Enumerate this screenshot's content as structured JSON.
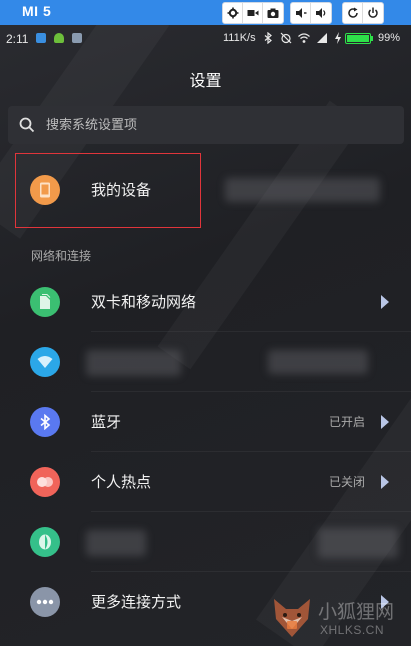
{
  "emulator": {
    "title": "MI 5",
    "buttons_left": [
      "gear-icon",
      "camera-video-icon",
      "camera-icon"
    ],
    "buttons_mid": [
      "volume-down-icon",
      "volume-up-icon"
    ],
    "buttons_right": [
      "rotate-icon",
      "power-icon"
    ]
  },
  "status_bar": {
    "time": "2:11",
    "net_speed": "111K/s",
    "battery_percent": "99%",
    "battery_level": 0.99
  },
  "header": {
    "title": "设置"
  },
  "search": {
    "placeholder": "搜索系统设置项"
  },
  "my_device": {
    "label": "我的设备",
    "icon": "phone-icon",
    "icon_color": "#f29a4a"
  },
  "section": {
    "title": "网络和连接"
  },
  "items": [
    {
      "label": "双卡和移动网络",
      "value": "",
      "icon": "sim-icon",
      "color": "#3bbf72"
    },
    {
      "label": "",
      "value": "",
      "icon": "wifi-icon",
      "color": "#2ba7e8"
    },
    {
      "label": "蓝牙",
      "value": "已开启",
      "icon": "bluetooth-icon",
      "color": "#5a79f0"
    },
    {
      "label": "个人热点",
      "value": "已关闭",
      "icon": "hotspot-icon",
      "color": "#f0645a"
    },
    {
      "label": "",
      "value": "",
      "icon": "vpn-icon",
      "color": "#35c08a"
    },
    {
      "label": "更多连接方式",
      "value": "",
      "icon": "more-icon",
      "color": "#8a95a8"
    }
  ],
  "watermark": {
    "text": "小狐狸网",
    "sub": "XHLKS.CN"
  },
  "colors": {
    "accent": "#3389e8",
    "highlight": "#e0353b",
    "battery": "#2ee04a"
  }
}
